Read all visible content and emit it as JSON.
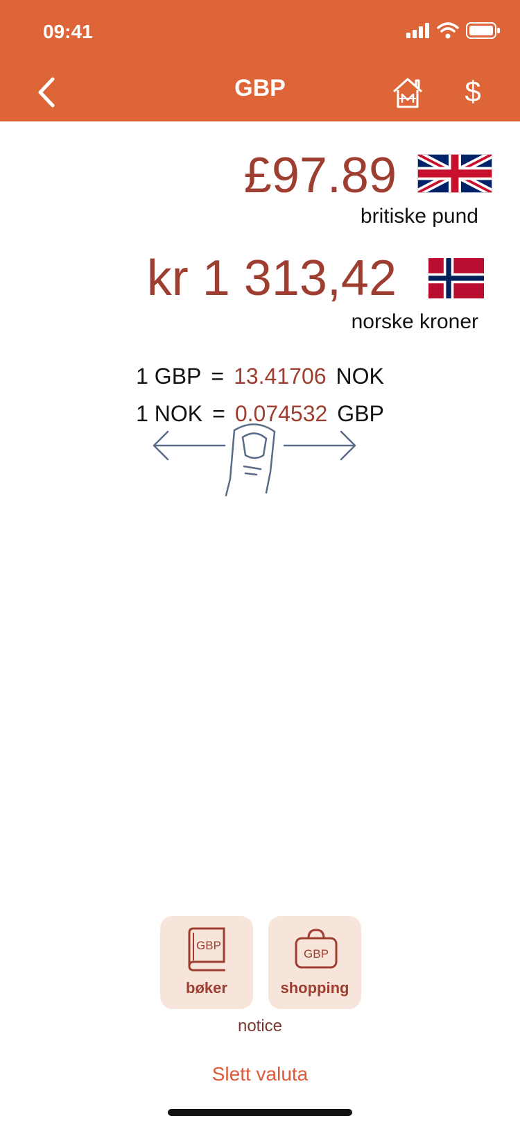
{
  "status_bar": {
    "time": "09:41"
  },
  "header": {
    "title": "GBP"
  },
  "converter": {
    "primary": {
      "amount": "£97.89",
      "currency_name": "britiske pund"
    },
    "secondary": {
      "amount": "kr 1 313,42",
      "currency_name": "norske kroner"
    }
  },
  "rates": {
    "row1": {
      "left": "1 GBP",
      "equals": "=",
      "value": "13.41706",
      "right": "NOK"
    },
    "row2": {
      "left": "1 NOK",
      "equals": "=",
      "value": "0.074532",
      "right": "GBP"
    }
  },
  "tiles": [
    {
      "label": "bøker",
      "icon_text": "GBP",
      "icon": "book-icon"
    },
    {
      "label": "shopping",
      "icon_text": "GBP",
      "icon": "shopping-bag-icon"
    }
  ],
  "notice": "notice",
  "delete_label": "Slett valuta",
  "colors": {
    "header": "#DD6537",
    "amount": "#9E3E30",
    "tile_bg": "#F7E5DB",
    "delete": "#DD5A3A"
  }
}
